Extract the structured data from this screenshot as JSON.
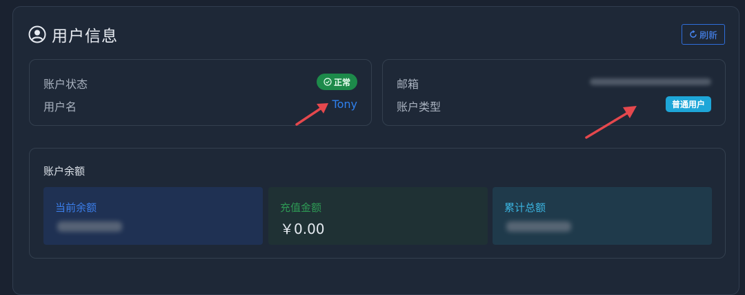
{
  "header": {
    "title": "用户信息",
    "refresh_label": "刷新"
  },
  "account_panel": {
    "status_label": "账户状态",
    "status_value": "正常",
    "username_label": "用户名",
    "username_value": "Tony"
  },
  "type_panel": {
    "email_label": "邮箱",
    "type_label": "账户类型",
    "type_value": "普通用户"
  },
  "balance": {
    "title": "账户余额",
    "items": [
      {
        "label": "当前余额"
      },
      {
        "label": "充值金额",
        "value": "￥0.00"
      },
      {
        "label": "累计总额"
      }
    ]
  },
  "colors": {
    "accent": "#2f80ed",
    "status_ok": "#1d8a4a",
    "type_badge": "#1ea6d8",
    "arrow": "#e5484d"
  }
}
